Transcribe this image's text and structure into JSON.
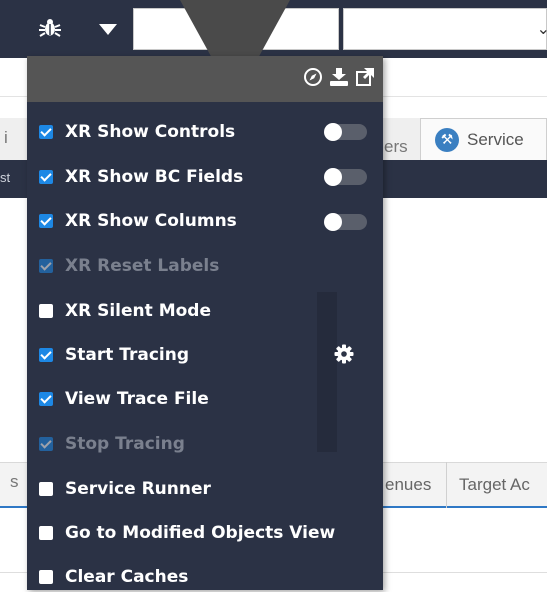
{
  "toolbar": {
    "bug_icon": "bug-icon",
    "dropdown_icon": "caret-down-icon",
    "input_value": "",
    "select_value": ""
  },
  "background": {
    "tab_fragment_left": "i",
    "tab_fragment_ers": "ers",
    "tab_services": "Service",
    "fragment_st": "st",
    "tab_fragment_s": "s",
    "tab_menues": "enues",
    "tab_target": "Target Ac"
  },
  "panel": {
    "header_icons": [
      "compass-icon",
      "download-icon",
      "external-link-icon"
    ],
    "items": [
      {
        "label": "XR Show Controls",
        "checked": true,
        "disabled": false,
        "toggle": true
      },
      {
        "label": "XR Show BC Fields",
        "checked": true,
        "disabled": false,
        "toggle": true
      },
      {
        "label": "XR Show Columns",
        "checked": true,
        "disabled": false,
        "toggle": true
      },
      {
        "label": "XR Reset Labels",
        "checked": true,
        "disabled": true,
        "toggle": false
      },
      {
        "label": "XR Silent Mode",
        "checked": false,
        "disabled": false,
        "toggle": false
      },
      {
        "label": "Start Tracing",
        "checked": true,
        "disabled": false,
        "toggle": false
      },
      {
        "label": "View Trace File",
        "checked": true,
        "disabled": false,
        "toggle": false
      },
      {
        "label": "Stop Tracing",
        "checked": true,
        "disabled": true,
        "toggle": false
      },
      {
        "label": "Service Runner",
        "checked": false,
        "disabled": false,
        "toggle": false
      },
      {
        "label": "Go to Modified Objects View",
        "checked": false,
        "disabled": false,
        "toggle": false
      },
      {
        "label": "Clear Caches",
        "checked": false,
        "disabled": false,
        "toggle": false
      }
    ],
    "gear_icon": "gear-icon",
    "accent_color": "#1d88e5"
  }
}
